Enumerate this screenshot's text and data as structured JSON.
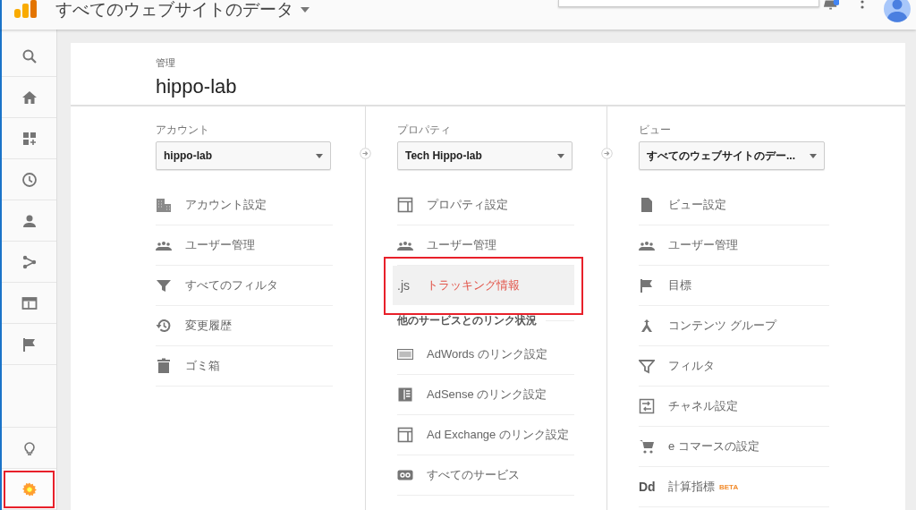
{
  "topbar": {
    "title": "すべてのウェブサイトのデータ"
  },
  "sidebar": {
    "items": [
      {
        "selected": false,
        "annotated": false
      },
      {
        "selected": false,
        "annotated": false
      },
      {
        "selected": false,
        "annotated": false
      },
      {
        "selected": false,
        "annotated": false
      },
      {
        "selected": false,
        "annotated": false
      },
      {
        "selected": false,
        "annotated": false
      },
      {
        "selected": false,
        "annotated": false
      },
      {
        "selected": false,
        "annotated": false
      },
      {
        "selected": false,
        "annotated": false
      },
      {
        "selected": true,
        "annotated": true
      }
    ]
  },
  "admin": {
    "label": "管理",
    "title": "hippo-lab"
  },
  "columns": [
    {
      "label": "アカウント",
      "dropdown": "hippo-lab",
      "items": [
        {
          "kind": "item",
          "label": "アカウント設定",
          "selected": false,
          "annotated": false
        },
        {
          "kind": "item",
          "label": "ユーザー管理",
          "selected": false,
          "annotated": false
        },
        {
          "kind": "item",
          "label": "すべてのフィルタ",
          "selected": false,
          "annotated": false
        },
        {
          "kind": "item",
          "label": "変更履歴",
          "selected": false,
          "annotated": false
        },
        {
          "kind": "item",
          "label": "ゴミ箱",
          "selected": false,
          "annotated": false
        }
      ]
    },
    {
      "label": "プロパティ",
      "dropdown": "Tech Hippo-lab",
      "items": [
        {
          "kind": "item",
          "label": "プロパティ設定",
          "selected": false,
          "annotated": false
        },
        {
          "kind": "item",
          "label": "ユーザー管理",
          "selected": false,
          "annotated": false
        },
        {
          "kind": "item",
          "label": "トラッキング情報",
          "icon_text": ".js",
          "selected": true,
          "annotated": true
        },
        {
          "kind": "heading",
          "label": "他のサービスとのリンク状況"
        },
        {
          "kind": "item",
          "label": "AdWords のリンク設定",
          "selected": false,
          "annotated": false
        },
        {
          "kind": "item",
          "label": "AdSense のリンク設定",
          "selected": false,
          "annotated": false
        },
        {
          "kind": "item",
          "label": "Ad Exchange のリンク設定",
          "selected": false,
          "annotated": false
        },
        {
          "kind": "item",
          "label": "すべてのサービス",
          "selected": false,
          "annotated": false
        }
      ]
    },
    {
      "label": "ビュー",
      "dropdown": "すべてのウェブサイトのデー...",
      "items": [
        {
          "kind": "item",
          "label": "ビュー設定",
          "selected": false,
          "annotated": false
        },
        {
          "kind": "item",
          "label": "ユーザー管理",
          "selected": false,
          "annotated": false
        },
        {
          "kind": "item",
          "label": "目標",
          "selected": false,
          "annotated": false
        },
        {
          "kind": "item",
          "label": "コンテンツ グループ",
          "selected": false,
          "annotated": false
        },
        {
          "kind": "item",
          "label": "フィルタ",
          "selected": false,
          "annotated": false
        },
        {
          "kind": "item",
          "label": "チャネル設定",
          "selected": false,
          "annotated": false
        },
        {
          "kind": "item",
          "label": "e コマースの設定",
          "selected": false,
          "annotated": false
        },
        {
          "kind": "item",
          "label": "計算指標",
          "icon_text": "Dd",
          "badge": "BETA",
          "selected": false,
          "annotated": false
        }
      ]
    }
  ]
}
